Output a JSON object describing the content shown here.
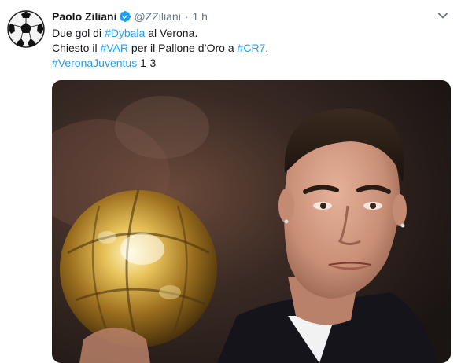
{
  "tweet": {
    "display_name": "Paolo Ziliani",
    "handle": "@ZZiliani",
    "separator": "·",
    "timestamp": "1 h",
    "avatar_icon": "soccer-ball-icon",
    "verified_icon": "verified-badge-icon",
    "menu_icon": "chevron-down-icon",
    "text": {
      "line1": {
        "before": "Due gol di ",
        "hashtag": "#Dybala",
        "after": " al Verona."
      },
      "line2": {
        "before": "Chiesto il ",
        "hashtag1": "#VAR",
        "middle": " per il Pallone d’Oro a ",
        "hashtag2": "#CR7",
        "after": "."
      },
      "line3": {
        "hashtag": "#VeronaJuventus",
        "after": " 1-3"
      }
    },
    "media_description_icon": "photo-ballon-dor-icon"
  },
  "colors": {
    "text": "#14171a",
    "secondary": "#657786",
    "link": "#1da1f2",
    "verified": "#1da1f2"
  }
}
